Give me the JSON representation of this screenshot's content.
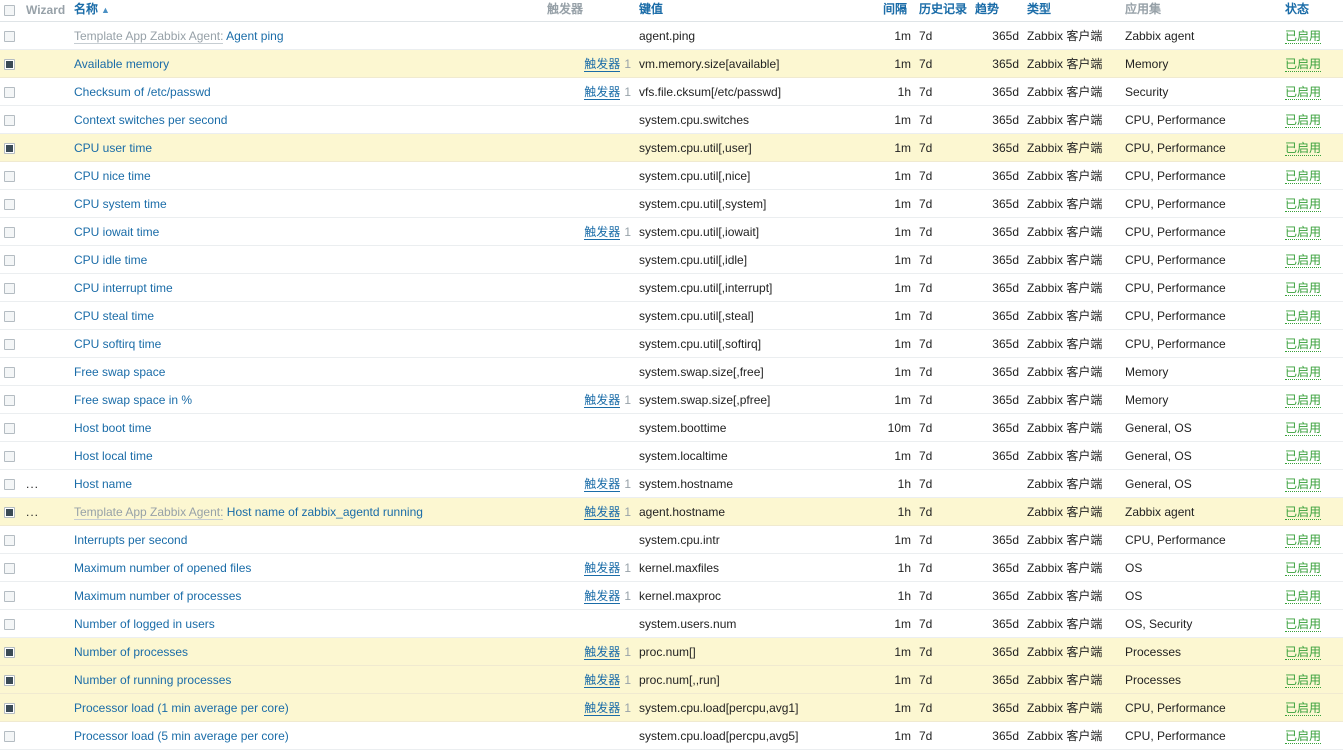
{
  "table": {
    "headers": {
      "select_all": "select-all-checkbox",
      "wizard": "Wizard",
      "name": "名称",
      "sort_arrow": "▲",
      "triggers": "触发器",
      "key": "键值",
      "interval": "间隔",
      "history": "历史记录",
      "trends": "趋势",
      "type": "类型",
      "applications": "应用集",
      "status": "状态"
    },
    "rows": [
      {
        "checked": false,
        "wizard": "",
        "template_prefix": "Template App Zabbix Agent:",
        "name": "Agent ping",
        "trigger_label": "",
        "trigger_count": "",
        "key": "agent.ping",
        "interval": "1m",
        "history": "7d",
        "trends": "365d",
        "type": "Zabbix 客户端",
        "applications": "Zabbix agent",
        "status": "已启用"
      },
      {
        "checked": true,
        "wizard": "",
        "template_prefix": "",
        "name": "Available memory",
        "trigger_label": "触发器",
        "trigger_count": "1",
        "key": "vm.memory.size[available]",
        "interval": "1m",
        "history": "7d",
        "trends": "365d",
        "type": "Zabbix 客户端",
        "applications": "Memory",
        "status": "已启用"
      },
      {
        "checked": false,
        "wizard": "",
        "template_prefix": "",
        "name": "Checksum of /etc/passwd",
        "trigger_label": "触发器",
        "trigger_count": "1",
        "key": "vfs.file.cksum[/etc/passwd]",
        "interval": "1h",
        "history": "7d",
        "trends": "365d",
        "type": "Zabbix 客户端",
        "applications": "Security",
        "status": "已启用"
      },
      {
        "checked": false,
        "wizard": "",
        "template_prefix": "",
        "name": "Context switches per second",
        "trigger_label": "",
        "trigger_count": "",
        "key": "system.cpu.switches",
        "interval": "1m",
        "history": "7d",
        "trends": "365d",
        "type": "Zabbix 客户端",
        "applications": "CPU, Performance",
        "status": "已启用"
      },
      {
        "checked": true,
        "wizard": "",
        "template_prefix": "",
        "name": "CPU user time",
        "trigger_label": "",
        "trigger_count": "",
        "key": "system.cpu.util[,user]",
        "interval": "1m",
        "history": "7d",
        "trends": "365d",
        "type": "Zabbix 客户端",
        "applications": "CPU, Performance",
        "status": "已启用"
      },
      {
        "checked": false,
        "wizard": "",
        "template_prefix": "",
        "name": "CPU nice time",
        "trigger_label": "",
        "trigger_count": "",
        "key": "system.cpu.util[,nice]",
        "interval": "1m",
        "history": "7d",
        "trends": "365d",
        "type": "Zabbix 客户端",
        "applications": "CPU, Performance",
        "status": "已启用"
      },
      {
        "checked": false,
        "wizard": "",
        "template_prefix": "",
        "name": "CPU system time",
        "trigger_label": "",
        "trigger_count": "",
        "key": "system.cpu.util[,system]",
        "interval": "1m",
        "history": "7d",
        "trends": "365d",
        "type": "Zabbix 客户端",
        "applications": "CPU, Performance",
        "status": "已启用"
      },
      {
        "checked": false,
        "wizard": "",
        "template_prefix": "",
        "name": "CPU iowait time",
        "trigger_label": "触发器",
        "trigger_count": "1",
        "key": "system.cpu.util[,iowait]",
        "interval": "1m",
        "history": "7d",
        "trends": "365d",
        "type": "Zabbix 客户端",
        "applications": "CPU, Performance",
        "status": "已启用"
      },
      {
        "checked": false,
        "wizard": "",
        "template_prefix": "",
        "name": "CPU idle time",
        "trigger_label": "",
        "trigger_count": "",
        "key": "system.cpu.util[,idle]",
        "interval": "1m",
        "history": "7d",
        "trends": "365d",
        "type": "Zabbix 客户端",
        "applications": "CPU, Performance",
        "status": "已启用"
      },
      {
        "checked": false,
        "wizard": "",
        "template_prefix": "",
        "name": "CPU interrupt time",
        "trigger_label": "",
        "trigger_count": "",
        "key": "system.cpu.util[,interrupt]",
        "interval": "1m",
        "history": "7d",
        "trends": "365d",
        "type": "Zabbix 客户端",
        "applications": "CPU, Performance",
        "status": "已启用"
      },
      {
        "checked": false,
        "wizard": "",
        "template_prefix": "",
        "name": "CPU steal time",
        "trigger_label": "",
        "trigger_count": "",
        "key": "system.cpu.util[,steal]",
        "interval": "1m",
        "history": "7d",
        "trends": "365d",
        "type": "Zabbix 客户端",
        "applications": "CPU, Performance",
        "status": "已启用"
      },
      {
        "checked": false,
        "wizard": "",
        "template_prefix": "",
        "name": "CPU softirq time",
        "trigger_label": "",
        "trigger_count": "",
        "key": "system.cpu.util[,softirq]",
        "interval": "1m",
        "history": "7d",
        "trends": "365d",
        "type": "Zabbix 客户端",
        "applications": "CPU, Performance",
        "status": "已启用"
      },
      {
        "checked": false,
        "wizard": "",
        "template_prefix": "",
        "name": "Free swap space",
        "trigger_label": "",
        "trigger_count": "",
        "key": "system.swap.size[,free]",
        "interval": "1m",
        "history": "7d",
        "trends": "365d",
        "type": "Zabbix 客户端",
        "applications": "Memory",
        "status": "已启用"
      },
      {
        "checked": false,
        "wizard": "",
        "template_prefix": "",
        "name": "Free swap space in %",
        "trigger_label": "触发器",
        "trigger_count": "1",
        "key": "system.swap.size[,pfree]",
        "interval": "1m",
        "history": "7d",
        "trends": "365d",
        "type": "Zabbix 客户端",
        "applications": "Memory",
        "status": "已启用"
      },
      {
        "checked": false,
        "wizard": "",
        "template_prefix": "",
        "name": "Host boot time",
        "trigger_label": "",
        "trigger_count": "",
        "key": "system.boottime",
        "interval": "10m",
        "history": "7d",
        "trends": "365d",
        "type": "Zabbix 客户端",
        "applications": "General, OS",
        "status": "已启用"
      },
      {
        "checked": false,
        "wizard": "",
        "template_prefix": "",
        "name": "Host local time",
        "trigger_label": "",
        "trigger_count": "",
        "key": "system.localtime",
        "interval": "1m",
        "history": "7d",
        "trends": "365d",
        "type": "Zabbix 客户端",
        "applications": "General, OS",
        "status": "已启用"
      },
      {
        "checked": false,
        "wizard": "...",
        "template_prefix": "",
        "name": "Host name",
        "trigger_label": "触发器",
        "trigger_count": "1",
        "key": "system.hostname",
        "interval": "1h",
        "history": "7d",
        "trends": "",
        "type": "Zabbix 客户端",
        "applications": "General, OS",
        "status": "已启用"
      },
      {
        "checked": true,
        "wizard": "...",
        "template_prefix": "Template App Zabbix Agent:",
        "name": "Host name of zabbix_agentd running",
        "trigger_label": "触发器",
        "trigger_count": "1",
        "key": "agent.hostname",
        "interval": "1h",
        "history": "7d",
        "trends": "",
        "type": "Zabbix 客户端",
        "applications": "Zabbix agent",
        "status": "已启用"
      },
      {
        "checked": false,
        "wizard": "",
        "template_prefix": "",
        "name": "Interrupts per second",
        "trigger_label": "",
        "trigger_count": "",
        "key": "system.cpu.intr",
        "interval": "1m",
        "history": "7d",
        "trends": "365d",
        "type": "Zabbix 客户端",
        "applications": "CPU, Performance",
        "status": "已启用"
      },
      {
        "checked": false,
        "wizard": "",
        "template_prefix": "",
        "name": "Maximum number of opened files",
        "trigger_label": "触发器",
        "trigger_count": "1",
        "key": "kernel.maxfiles",
        "interval": "1h",
        "history": "7d",
        "trends": "365d",
        "type": "Zabbix 客户端",
        "applications": "OS",
        "status": "已启用"
      },
      {
        "checked": false,
        "wizard": "",
        "template_prefix": "",
        "name": "Maximum number of processes",
        "trigger_label": "触发器",
        "trigger_count": "1",
        "key": "kernel.maxproc",
        "interval": "1h",
        "history": "7d",
        "trends": "365d",
        "type": "Zabbix 客户端",
        "applications": "OS",
        "status": "已启用"
      },
      {
        "checked": false,
        "wizard": "",
        "template_prefix": "",
        "name": "Number of logged in users",
        "trigger_label": "",
        "trigger_count": "",
        "key": "system.users.num",
        "interval": "1m",
        "history": "7d",
        "trends": "365d",
        "type": "Zabbix 客户端",
        "applications": "OS, Security",
        "status": "已启用"
      },
      {
        "checked": true,
        "wizard": "",
        "template_prefix": "",
        "name": "Number of processes",
        "trigger_label": "触发器",
        "trigger_count": "1",
        "key": "proc.num[]",
        "interval": "1m",
        "history": "7d",
        "trends": "365d",
        "type": "Zabbix 客户端",
        "applications": "Processes",
        "status": "已启用"
      },
      {
        "checked": true,
        "wizard": "",
        "template_prefix": "",
        "name": "Number of running processes",
        "trigger_label": "触发器",
        "trigger_count": "1",
        "key": "proc.num[,,run]",
        "interval": "1m",
        "history": "7d",
        "trends": "365d",
        "type": "Zabbix 客户端",
        "applications": "Processes",
        "status": "已启用"
      },
      {
        "checked": true,
        "wizard": "",
        "template_prefix": "",
        "name": "Processor load (1 min average per core)",
        "trigger_label": "触发器",
        "trigger_count": "1",
        "key": "system.cpu.load[percpu,avg1]",
        "interval": "1m",
        "history": "7d",
        "trends": "365d",
        "type": "Zabbix 客户端",
        "applications": "CPU, Performance",
        "status": "已启用"
      },
      {
        "checked": false,
        "wizard": "",
        "template_prefix": "",
        "name": "Processor load (5 min average per core)",
        "trigger_label": "",
        "trigger_count": "",
        "key": "system.cpu.load[percpu,avg5]",
        "interval": "1m",
        "history": "7d",
        "trends": "365d",
        "type": "Zabbix 客户端",
        "applications": "CPU, Performance",
        "status": "已启用"
      }
    ]
  }
}
